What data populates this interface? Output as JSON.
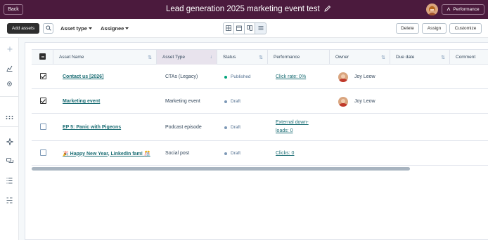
{
  "header": {
    "back_label": "Back",
    "title": "Lead generation 2025 marketing event test",
    "performance_label": "Performance"
  },
  "toolbar": {
    "add_label": "Add assets",
    "filter_asset_type": "Asset type",
    "filter_assignee": "Assignee",
    "delete_label": "Delete",
    "assign_label": "Assign",
    "customize_label": "Customize"
  },
  "table": {
    "columns": [
      "Asset Name",
      "Asset Type",
      "Status",
      "Performance",
      "Owner",
      "Due date",
      "Comment"
    ],
    "sorted_column": "Asset Type",
    "rows": [
      {
        "checked": true,
        "name": "Contact us [2026]",
        "type": "CTAs (Legacy)",
        "status": "Published",
        "status_color": "#00a37a",
        "performance": "Click rate: 0%",
        "owner": "Joy Leow"
      },
      {
        "checked": true,
        "name": "Marketing event",
        "type": "Marketing event",
        "status": "Draft",
        "status_color": "#7c98b6",
        "performance": "",
        "owner": "Joy Leow"
      },
      {
        "checked": false,
        "name": "EP 5: Panic with Pigeons",
        "type": "Podcast episode",
        "status": "Draft",
        "status_color": "#7c98b6",
        "performance_line1": "External down-",
        "performance_line2": "loads: 0",
        "owner": ""
      },
      {
        "checked": false,
        "name": "🎉 Happy New Year, LinkedIn fam! 🎊",
        "type": "Social post",
        "status": "Draft",
        "status_color": "#7c98b6",
        "performance": "Clicks: 0",
        "owner": ""
      }
    ]
  },
  "icons": {
    "sidebar": [
      "plus-icon",
      "chart-icon",
      "gear-icon",
      "dots-icon",
      "sparkle-icon",
      "chat-icon",
      "list-icon",
      "checklist-icon"
    ]
  },
  "colors": {
    "header_bg": "#4b1a3d",
    "link": "#1b6d74",
    "published": "#00a37a"
  }
}
